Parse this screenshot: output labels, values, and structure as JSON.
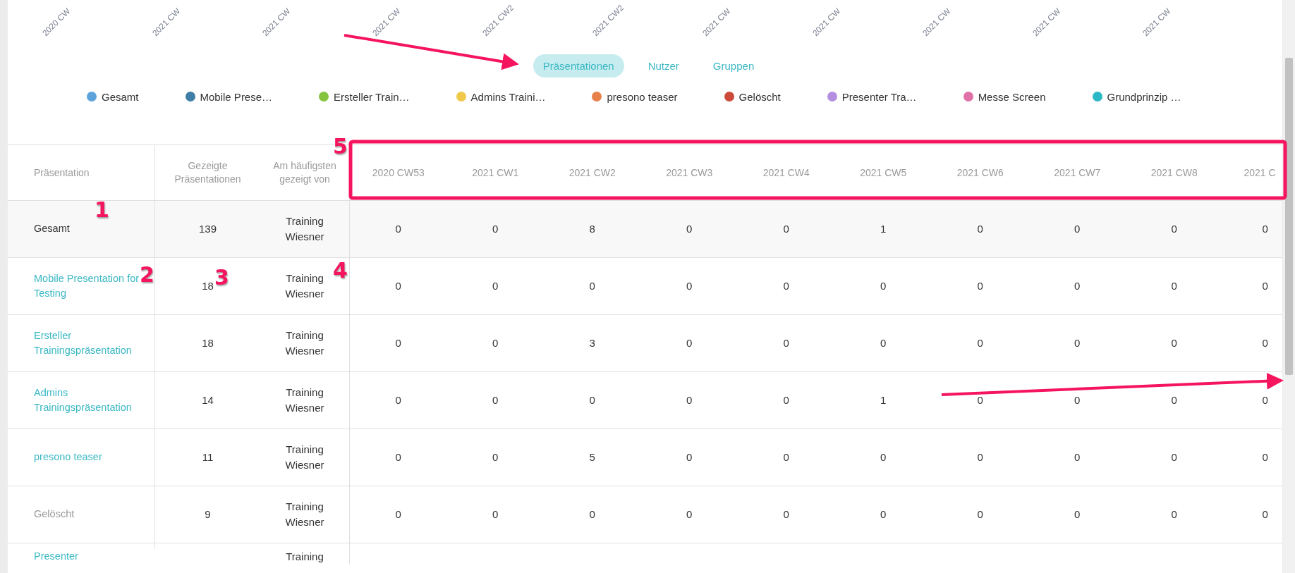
{
  "chart_axis_labels": [
    "2020 CW",
    "2021 CW",
    "2021 CW",
    "2021 CW",
    "2021 CW2",
    "2021 CW2",
    "2021 CW",
    "2021 CW",
    "2021 CW",
    "2021 CW",
    "2021 CW"
  ],
  "tabs": [
    {
      "label": "Präsentationen",
      "selected": true
    },
    {
      "label": "Nutzer",
      "selected": false
    },
    {
      "label": "Gruppen",
      "selected": false
    }
  ],
  "legend": [
    {
      "label": "Gesamt",
      "color": "#5ca3dc"
    },
    {
      "label": "Mobile Prese…",
      "color": "#3f7ea6"
    },
    {
      "label": "Ersteller Train…",
      "color": "#86c440"
    },
    {
      "label": "Admins Traini…",
      "color": "#f0c94a"
    },
    {
      "label": "presono teaser",
      "color": "#e8804a"
    },
    {
      "label": "Gelöscht",
      "color": "#cc4a3a"
    },
    {
      "label": "Presenter Tra…",
      "color": "#b48fe0"
    },
    {
      "label": "Messe Screen",
      "color": "#e070a8"
    },
    {
      "label": "Grundprinzip …",
      "color": "#2ab8c4"
    }
  ],
  "table": {
    "columns": [
      "Präsentation",
      "Gezeigte Präsentationen",
      "Am häufigsten gezeigt von",
      "2020 CW53",
      "2021 CW1",
      "2021 CW2",
      "2021 CW3",
      "2021 CW4",
      "2021 CW5",
      "2021 CW6",
      "2021 CW7",
      "2021 CW8",
      "2021 C"
    ],
    "rows": [
      {
        "kind": "total",
        "name": "Gesamt",
        "shown": "139",
        "shown_by": "Training Wiesner",
        "weeks": [
          "0",
          "0",
          "8",
          "0",
          "0",
          "1",
          "0",
          "0",
          "0",
          "0"
        ]
      },
      {
        "kind": "link",
        "name": "Mobile Presentation for Testing",
        "shown": "18",
        "shown_by": "Training Wiesner",
        "weeks": [
          "0",
          "0",
          "0",
          "0",
          "0",
          "0",
          "0",
          "0",
          "0",
          "0"
        ]
      },
      {
        "kind": "link",
        "name": "Ersteller Trainingspräsentation",
        "shown": "18",
        "shown_by": "Training Wiesner",
        "weeks": [
          "0",
          "0",
          "3",
          "0",
          "0",
          "0",
          "0",
          "0",
          "0",
          "0"
        ]
      },
      {
        "kind": "link",
        "name": "Admins Trainingspräsentation",
        "shown": "14",
        "shown_by": "Training Wiesner",
        "weeks": [
          "0",
          "0",
          "0",
          "0",
          "0",
          "1",
          "0",
          "0",
          "0",
          "0"
        ]
      },
      {
        "kind": "link",
        "name": "presono teaser",
        "shown": "11",
        "shown_by": "Training Wiesner",
        "weeks": [
          "0",
          "0",
          "5",
          "0",
          "0",
          "0",
          "0",
          "0",
          "0",
          "0"
        ]
      },
      {
        "kind": "deleted",
        "name": "Gelöscht",
        "shown": "9",
        "shown_by": "Training Wiesner",
        "weeks": [
          "0",
          "0",
          "0",
          "0",
          "0",
          "0",
          "0",
          "0",
          "0",
          "0"
        ]
      },
      {
        "kind": "link",
        "name": "Presenter",
        "shown": "",
        "shown_by": "Training",
        "weeks": []
      }
    ]
  },
  "annotations": [
    {
      "label": "1"
    },
    {
      "label": "2"
    },
    {
      "label": "3"
    },
    {
      "label": "4"
    },
    {
      "label": "5"
    }
  ]
}
